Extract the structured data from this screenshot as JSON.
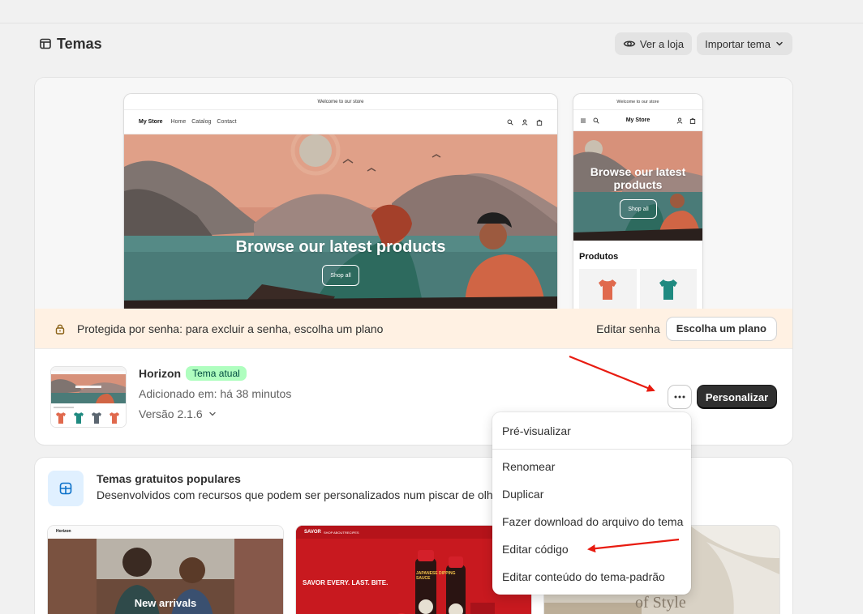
{
  "header": {
    "title": "Temas",
    "view_store_label": "Ver a loja",
    "import_theme_label": "Importar tema"
  },
  "current_theme": {
    "preview": {
      "announcement": "Welcome to our store",
      "store_name": "My Store",
      "nav_links": [
        "Home",
        "Catalog",
        "Contact"
      ],
      "hero_title": "Browse our latest products",
      "hero_button": "Shop all",
      "mobile_products_heading": "Produtos"
    },
    "password_banner": {
      "text": "Protegida por senha: para excluir a senha, escolha um plano",
      "edit_password_label": "Editar senha",
      "choose_plan_label": "Escolha um plano"
    },
    "name": "Horizon",
    "badge": "Tema atual",
    "added": "Adicionado em: há 38 minutos",
    "version": "Versão 2.1.6",
    "customize_label": "Personalizar"
  },
  "actions_menu": {
    "items": [
      "Pré-visualizar",
      "Renomear",
      "Duplicar",
      "Fazer download do arquivo do tema",
      "Editar código",
      "Editar conteúdo do tema-padrão"
    ]
  },
  "free_themes": {
    "title": "Temas gratuitos populares",
    "description": "Desenvolvidos com recursos que podem ser personalizados num piscar de olhos, sem necessidade de código.",
    "tiles": [
      {
        "store_name": "Horizon",
        "hero_text": "New arrivals"
      },
      {
        "store_name": "SAVOR",
        "nav": [
          "SHOP",
          "ABOUT",
          "RECIPES"
        ],
        "hero_text": "SAVOR EVERY. LAST. BITE.",
        "product_label": "JAPANESE DIPPING SAUCE"
      },
      {
        "hero_text": "of Style"
      }
    ]
  },
  "colors": {
    "page_bg": "#f1f1f1",
    "primary_button": "#303030",
    "badge_bg": "#affebf",
    "banner_bg": "#fff1e3",
    "annotation_arrow": "#e81b10"
  }
}
